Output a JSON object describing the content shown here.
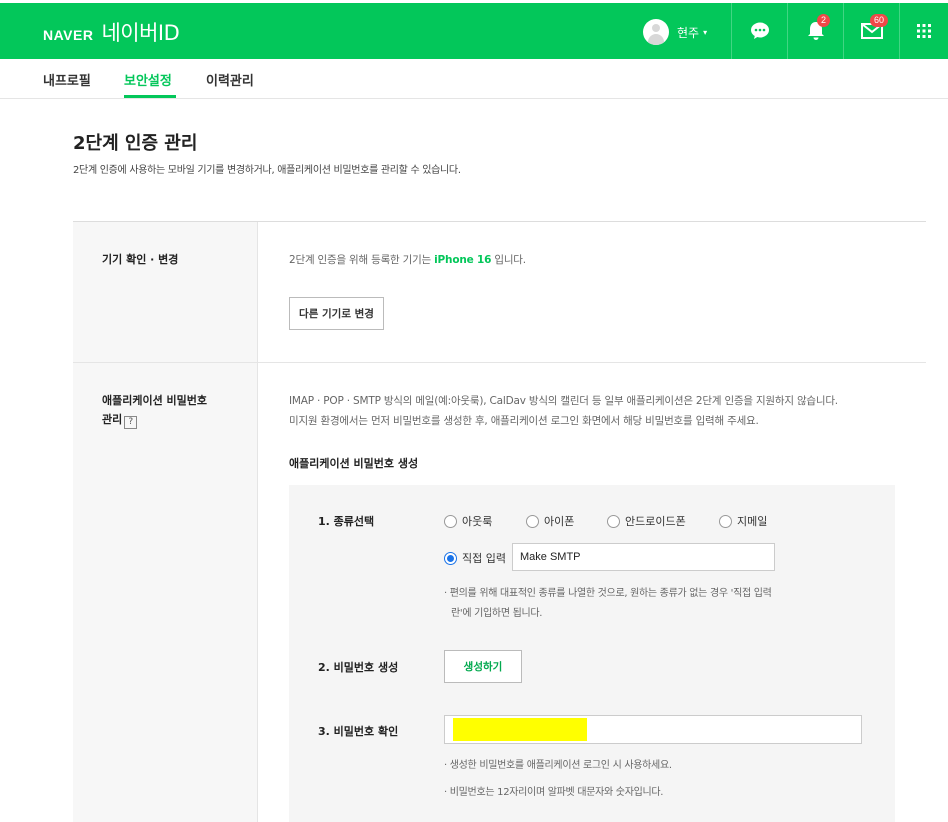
{
  "header": {
    "logo_naver": "NAVER",
    "logo_id": "네이버ID",
    "user_name": "현주",
    "user_caret": "▾",
    "notification_count": "2",
    "mail_count": "60",
    "brand_color": "#03c75a"
  },
  "tabs": [
    {
      "label": "내프로필"
    },
    {
      "label": "보안설정",
      "active": true
    },
    {
      "label": "이력관리"
    }
  ],
  "page": {
    "title": "2단계 인증 관리",
    "description": "2단계 인증에 사용하는 모바일 기기를 변경하거나, 애플리케이션 비밀번호를 관리할 수 있습니다."
  },
  "device_section": {
    "label": "기기 확인 · 변경",
    "text_before": "2단계 인증을 위해 등록한 기기는 ",
    "device_name": "iPhone 16",
    "text_after": " 입니다.",
    "change_button": "다른 기기로 변경"
  },
  "app_password_section": {
    "label_line1": "애플리케이션 비밀번호",
    "label_line2": "관리",
    "help_icon": "?",
    "desc_line1": "IMAP · POP · SMTP 방식의 메일(예:아웃룩), CalDav 방식의 캘린더 등 일부 애플리케이션은 2단계 인증을 지원하지 않습니다.",
    "desc_line2": "미지원 환경에서는 먼저 비밀번호를 생성한 후, 애플리케이션 로그인 화면에서 해당 비밀번호를 입력해 주세요.",
    "generate_title": "애플리케이션 비밀번호 생성",
    "step1": {
      "label": "1. 종류선택",
      "options": [
        "아웃룩",
        "아이폰",
        "안드로이드폰",
        "지메일"
      ],
      "custom_option": "직접 입력",
      "custom_value": "Make SMTP",
      "note_line1": "· 편의를 위해 대표적인 종류를 나열한 것으로, 원하는 종류가 없는 경우 '직접 입력",
      "note_line2": "란'에 기입하면 됩니다."
    },
    "step2": {
      "label": "2. 비밀번호 생성",
      "button": "생성하기"
    },
    "step3": {
      "label": "3. 비밀번호 확인",
      "note1": "· 생성한 비밀번호를 애플리케이션 로그인 시 사용하세요.",
      "note2": "· 비밀번호는 12자리이며 알파벳 대문자와 숫자입니다."
    }
  }
}
